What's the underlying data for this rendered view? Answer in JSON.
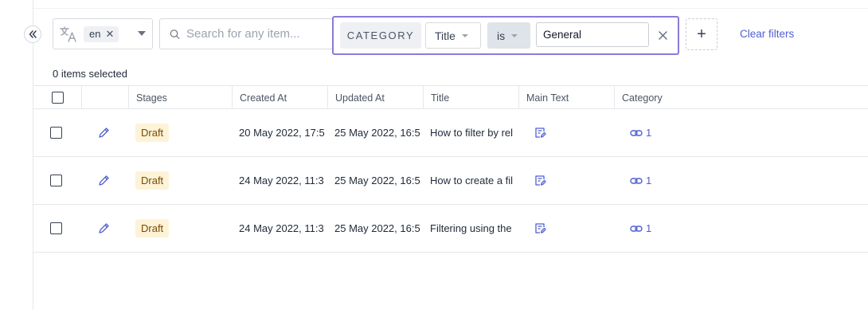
{
  "locale": {
    "chip": "en"
  },
  "search": {
    "placeholder": "Search for any item..."
  },
  "filter": {
    "category": "CATEGORY",
    "field": "Title",
    "operator": "is",
    "value": "General"
  },
  "actions": {
    "add": "+",
    "clear_filters": "Clear filters"
  },
  "selection": {
    "count_text": "0 items selected"
  },
  "table": {
    "columns": [
      "Stages",
      "Created At",
      "Updated At",
      "Title",
      "Main Text",
      "Category"
    ],
    "rows": [
      {
        "stage": "Draft",
        "created": "20 May 2022, 17:5",
        "updated": "25 May 2022, 16:5",
        "title": "How to filter by rel",
        "category_count": "1"
      },
      {
        "stage": "Draft",
        "created": "24 May 2022, 11:3",
        "updated": "25 May 2022, 16:5",
        "title": "How to create a fil",
        "category_count": "1"
      },
      {
        "stage": "Draft",
        "created": "24 May 2022, 11:3",
        "updated": "25 May 2022, 16:5",
        "title": "Filtering using the",
        "category_count": "1"
      }
    ]
  },
  "colors": {
    "accent": "#4f5fd0",
    "filter_border": "#8b7bd8",
    "draft_badge_bg": "#fdf3d7",
    "draft_badge_text": "#7a4a05"
  }
}
